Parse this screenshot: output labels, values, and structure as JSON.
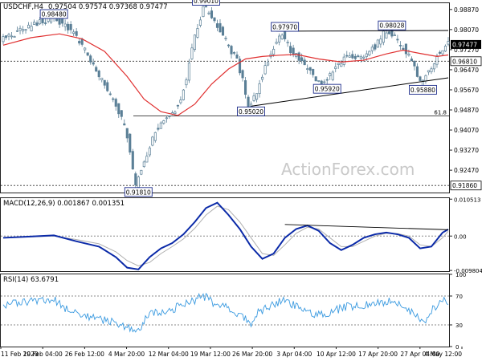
{
  "header": {
    "symbol": "USDCHF,H4",
    "ohlc": "0.97504 0.97574 0.97368 0.97477"
  },
  "watermark": "ActionForex.com",
  "colors": {
    "candle": "#5a7f96",
    "ma": "#e03030",
    "macd_line": "#0b2aa8",
    "signal_line": "#b0b0b0",
    "rsi_line": "#3a9ae0",
    "trendline": "#000000",
    "label_border": "#1a2a8a",
    "current_label_bg": "#000000"
  },
  "chart_data": [
    {
      "type": "candlestick",
      "title": "USDCHF,H4",
      "ylim": [
        0.9158,
        0.9912
      ],
      "y_ticks": [
        "0.98870",
        "0.98070",
        "0.97270",
        "0.96470",
        "0.95670",
        "0.94870",
        "0.94070",
        "0.93270",
        "0.92470"
      ],
      "x_ticks": [
        "11 Feb 2020",
        "19 Feb 04:00",
        "26 Feb 12:00",
        "4 Mar 20:00",
        "12 Mar 04:00",
        "19 Mar 12:00",
        "26 Mar 20:00",
        "3 Apr 04:00",
        "10 Apr 12:00",
        "17 Apr 20:00",
        "27 Apr 04:00",
        "4 May 12:00"
      ],
      "price_path": [
        [
          0,
          0.977
        ],
        [
          6,
          0.9795
        ],
        [
          12,
          0.983
        ],
        [
          18,
          0.9849
        ],
        [
          22,
          0.9835
        ],
        [
          26,
          0.979
        ],
        [
          30,
          0.972
        ],
        [
          34,
          0.964
        ],
        [
          38,
          0.956
        ],
        [
          42,
          0.948
        ],
        [
          45,
          0.938
        ],
        [
          48,
          0.9181
        ],
        [
          51,
          0.928
        ],
        [
          54,
          0.938
        ],
        [
          57,
          0.944
        ],
        [
          60,
          0.947
        ],
        [
          63,
          0.95
        ],
        [
          66,
          0.962
        ],
        [
          69,
          0.978
        ],
        [
          72,
          0.9901
        ],
        [
          75,
          0.986
        ],
        [
          78,
          0.98
        ],
        [
          81,
          0.974
        ],
        [
          84,
          0.968
        ],
        [
          86,
          0.96
        ],
        [
          88,
          0.9502
        ],
        [
          91,
          0.956
        ],
        [
          94,
          0.966
        ],
        [
          97,
          0.974
        ],
        [
          100,
          0.9797
        ],
        [
          103,
          0.972
        ],
        [
          106,
          0.969
        ],
        [
          109,
          0.965
        ],
        [
          112,
          0.96
        ],
        [
          115,
          0.9592
        ],
        [
          118,
          0.964
        ],
        [
          121,
          0.968
        ],
        [
          124,
          0.97
        ],
        [
          127,
          0.969
        ],
        [
          130,
          0.972
        ],
        [
          133,
          0.974
        ],
        [
          136,
          0.979
        ],
        [
          138,
          0.9803
        ],
        [
          141,
          0.976
        ],
        [
          144,
          0.972
        ],
        [
          147,
          0.966
        ],
        [
          149,
          0.9589
        ],
        [
          152,
          0.964
        ],
        [
          155,
          0.97
        ],
        [
          158,
          0.9748
        ]
      ],
      "ma_path": [
        [
          0,
          0.9745
        ],
        [
          10,
          0.9775
        ],
        [
          20,
          0.979
        ],
        [
          28,
          0.977
        ],
        [
          36,
          0.972
        ],
        [
          44,
          0.962
        ],
        [
          50,
          0.953
        ],
        [
          56,
          0.948
        ],
        [
          62,
          0.9465
        ],
        [
          68,
          0.951
        ],
        [
          74,
          0.959
        ],
        [
          80,
          0.965
        ],
        [
          86,
          0.969
        ],
        [
          92,
          0.97
        ],
        [
          98,
          0.9705
        ],
        [
          104,
          0.9708
        ],
        [
          112,
          0.969
        ],
        [
          120,
          0.9678
        ],
        [
          128,
          0.9685
        ],
        [
          136,
          0.971
        ],
        [
          142,
          0.9725
        ],
        [
          148,
          0.9712
        ],
        [
          154,
          0.97
        ],
        [
          158,
          0.9706
        ]
      ],
      "annotations": [
        {
          "label": "0.98480",
          "bar": 18,
          "value": 0.9848
        },
        {
          "label": "0.99010",
          "bar": 72,
          "value": 0.9901
        },
        {
          "label": "0.97970",
          "bar": 100,
          "value": 0.9797
        },
        {
          "label": "0.98028",
          "bar": 138,
          "value": 0.98028
        },
        {
          "label": "0.95920",
          "bar": 115,
          "value": 0.9592
        },
        {
          "label": "0.95880",
          "bar": 149,
          "value": 0.9588
        },
        {
          "label": "0.95020",
          "bar": 88,
          "value": 0.9502
        },
        {
          "label": "0.91810",
          "bar": 48,
          "value": 0.9181
        }
      ],
      "trendlines": [
        {
          "from": [
            97,
            0.98003
          ],
          "to": [
            158,
            0.98034
          ]
        },
        {
          "from": [
            88,
            0.9502
          ],
          "to": [
            158,
            0.9615
          ]
        }
      ],
      "hlines": [
        {
          "value": 0.9681,
          "style": "dotted",
          "label": "0.96810",
          "tag": ""
        },
        {
          "value": 0.9463,
          "style": "solid",
          "label": "",
          "tag": "61.8"
        },
        {
          "value": 0.9186,
          "style": "dotted",
          "label": "0.91860",
          "tag": ""
        }
      ],
      "current": {
        "label": "0.97477",
        "value": 0.97477
      }
    },
    {
      "type": "line",
      "title": "MACD(12,26,9) 0.001867 0.001351",
      "ylim": [
        -0.01,
        0.0108
      ],
      "y_ticks": [
        "0.010513",
        "0.00",
        "-0.009804"
      ],
      "series": [
        {
          "values": [
            [
              0,
              -0.0005
            ],
            [
              8,
              -0.0002
            ],
            [
              18,
              0.0002
            ],
            [
              26,
              -0.0015
            ],
            [
              34,
              -0.003
            ],
            [
              40,
              -0.006
            ],
            [
              44,
              -0.009
            ],
            [
              48,
              -0.0095
            ],
            [
              52,
              -0.006
            ],
            [
              56,
              -0.0035
            ],
            [
              60,
              -0.002
            ],
            [
              64,
              0.0005
            ],
            [
              68,
              0.004
            ],
            [
              72,
              0.008
            ],
            [
              76,
              0.0095
            ],
            [
              80,
              0.006
            ],
            [
              84,
              0.002
            ],
            [
              88,
              -0.003
            ],
            [
              92,
              -0.0065
            ],
            [
              96,
              -0.005
            ],
            [
              100,
              -0.0005
            ],
            [
              104,
              0.002
            ],
            [
              108,
              0.003
            ],
            [
              112,
              0.0015
            ],
            [
              116,
              -0.002
            ],
            [
              120,
              -0.004
            ],
            [
              124,
              -0.0025
            ],
            [
              128,
              -0.0005
            ],
            [
              132,
              0.0005
            ],
            [
              136,
              0.001
            ],
            [
              140,
              0.0005
            ],
            [
              144,
              -0.0005
            ],
            [
              148,
              -0.0035
            ],
            [
              152,
              -0.003
            ],
            [
              156,
              0.001
            ],
            [
              158,
              0.0019
            ]
          ]
        },
        {
          "values": [
            [
              0,
              -0.0004
            ],
            [
              8,
              -0.0003
            ],
            [
              18,
              0.0
            ],
            [
              26,
              -0.001
            ],
            [
              34,
              -0.0022
            ],
            [
              40,
              -0.0045
            ],
            [
              44,
              -0.007
            ],
            [
              48,
              -0.0085
            ],
            [
              52,
              -0.0075
            ],
            [
              56,
              -0.005
            ],
            [
              60,
              -0.003
            ],
            [
              64,
              -0.0008
            ],
            [
              68,
              0.0022
            ],
            [
              72,
              0.006
            ],
            [
              76,
              0.0085
            ],
            [
              80,
              0.0075
            ],
            [
              84,
              0.004
            ],
            [
              88,
              -0.0005
            ],
            [
              92,
              -0.005
            ],
            [
              96,
              -0.0055
            ],
            [
              100,
              -0.0025
            ],
            [
              104,
              0.0008
            ],
            [
              108,
              0.0025
            ],
            [
              112,
              0.002
            ],
            [
              116,
              -0.0005
            ],
            [
              120,
              -0.003
            ],
            [
              124,
              -0.003
            ],
            [
              128,
              -0.0015
            ],
            [
              132,
              0.0
            ],
            [
              136,
              0.0008
            ],
            [
              140,
              0.0007
            ],
            [
              144,
              0.0
            ],
            [
              148,
              -0.0025
            ],
            [
              152,
              -0.003
            ],
            [
              156,
              -0.0005
            ],
            [
              158,
              0.0014
            ]
          ]
        }
      ],
      "trendline": {
        "from": [
          100,
          0.0033
        ],
        "to": [
          158,
          0.0018
        ]
      }
    },
    {
      "type": "line",
      "title": "RSI(14) 63.6791",
      "ylim": [
        0,
        100
      ],
      "y_ticks": [
        "100",
        "70",
        "30",
        "0"
      ],
      "levels": [
        70,
        30
      ],
      "series": [
        {
          "values": [
            [
              0,
              58
            ],
            [
              4,
              62
            ],
            [
              8,
              60
            ],
            [
              12,
              64
            ],
            [
              16,
              61
            ],
            [
              18,
              65
            ],
            [
              20,
              58
            ],
            [
              24,
              50
            ],
            [
              28,
              44
            ],
            [
              32,
              40
            ],
            [
              36,
              36
            ],
            [
              40,
              33
            ],
            [
              44,
              28
            ],
            [
              48,
              20
            ],
            [
              50,
              35
            ],
            [
              52,
              44
            ],
            [
              56,
              48
            ],
            [
              60,
              52
            ],
            [
              64,
              58
            ],
            [
              68,
              64
            ],
            [
              70,
              68
            ],
            [
              72,
              70
            ],
            [
              74,
              62
            ],
            [
              78,
              55
            ],
            [
              82,
              50
            ],
            [
              86,
              40
            ],
            [
              88,
              32
            ],
            [
              90,
              45
            ],
            [
              94,
              55
            ],
            [
              98,
              62
            ],
            [
              100,
              66
            ],
            [
              104,
              55
            ],
            [
              108,
              48
            ],
            [
              112,
              44
            ],
            [
              115,
              42
            ],
            [
              118,
              50
            ],
            [
              122,
              56
            ],
            [
              126,
              55
            ],
            [
              130,
              58
            ],
            [
              134,
              60
            ],
            [
              138,
              64
            ],
            [
              140,
              58
            ],
            [
              144,
              50
            ],
            [
              148,
              38
            ],
            [
              150,
              35
            ],
            [
              152,
              50
            ],
            [
              156,
              62
            ],
            [
              158,
              64
            ]
          ]
        }
      ]
    }
  ]
}
